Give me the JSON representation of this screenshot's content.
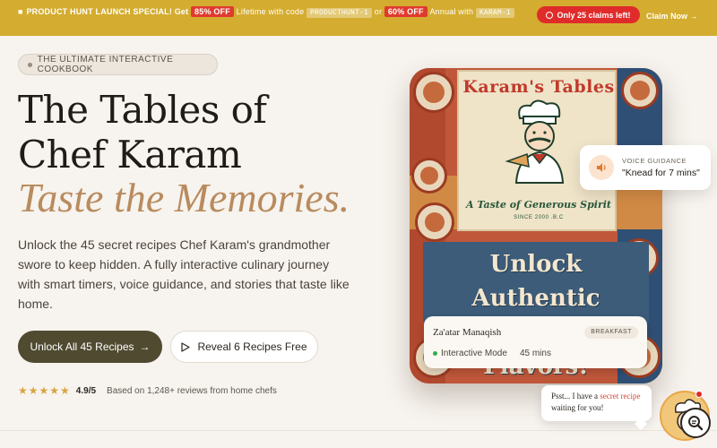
{
  "promo": {
    "lead": "PRODUCT HUNT LAUNCH SPECIAL! Get",
    "discount1": "85% OFF",
    "mid1": "Lifetime with code",
    "code1": "PRODUCTHUNT-1",
    "or": "or",
    "discount2": "60% OFF",
    "mid2": "Annual with",
    "code2": "KARAM-1",
    "claims": "Only 25 claims left!",
    "claim_now": "Claim Now →"
  },
  "hero": {
    "eyebrow": "THE ULTIMATE INTERACTIVE COOKBOOK",
    "title_line1": "The Tables of",
    "title_line2": "Chef Karam",
    "tagline": "Taste the Memories.",
    "description": "Unlock the 45 secret recipes Chef Karam's grandmother swore to keep hidden. A fully interactive culinary journey with smart timers, voice guidance, and stories that taste like home.",
    "primary_cta": "Unlock All 45 Recipes",
    "secondary_cta": "Reveal 6 Recipes Free",
    "stars": "★★★★★",
    "rating": "4.9/5",
    "reviews": "Based on 1,248+ reviews from home chefs"
  },
  "card": {
    "poster_title": "Karam's Tables",
    "poster_subtitle": "A Taste of Generous Spirit",
    "poster_since": "SINCE 2000 .B.C",
    "unlock_line1": "Unlock Authentic",
    "unlock_line2": "Lebeenise Flavors!",
    "recipe_name": "Za'atar Manaqish",
    "recipe_badge": "BREAKFAST",
    "recipe_mode": "Interactive Mode",
    "recipe_time": "45 mins"
  },
  "voice": {
    "label": "VOICE GUIDANCE",
    "value": "\"Knead for 7 mins\""
  },
  "chat": {
    "prefix": "Psst... I have a",
    "accent": "secret recipe",
    "suffix": "waiting for you!"
  },
  "colors": {
    "promo_bg": "#d4ac2f",
    "accent_red": "#e02b2b",
    "primary_btn": "#4f4a30",
    "tagline": "#b88b5e",
    "page_bg": "#f7f3ee"
  }
}
